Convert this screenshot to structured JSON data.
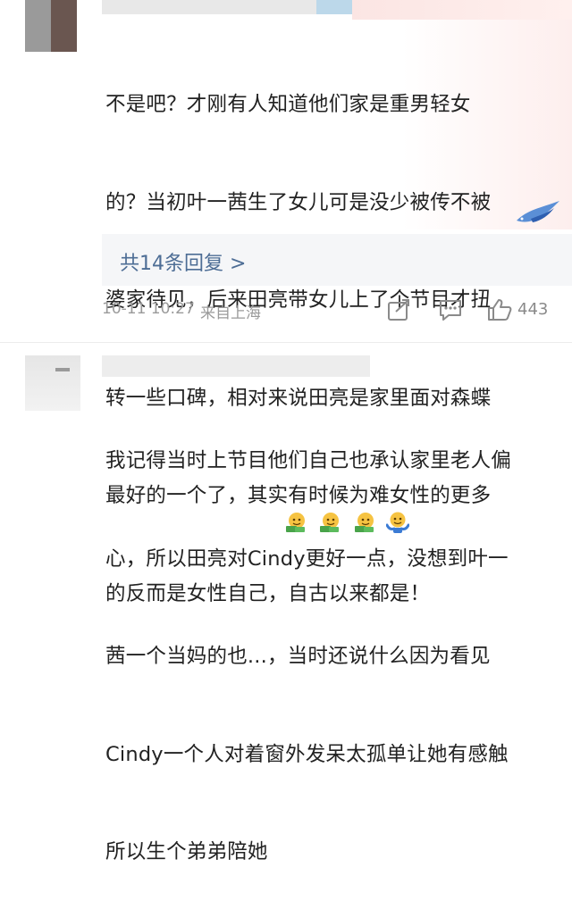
{
  "comment1": {
    "lines": [
      "不是吧？才刚有人知道他们家是重男轻女",
      "的？当初叶一茜生了女儿可是没少被传不被",
      "婆家待见，后来田亮带女儿上了个节目才扭",
      "转一些口碑，相对来说田亮是家里面对森蝶",
      "最好的一个了，其实有时候为难女性的更多",
      "的反而是女性自己，自古以来都是！"
    ],
    "replies_label": "共14条回复 >",
    "time": "10-11 10:27",
    "location": "来自上海",
    "like_count": "443",
    "icons": [
      "share-icon",
      "comment-icon",
      "like-icon"
    ]
  },
  "comment2": {
    "lines": [
      "我记得当时上节目他们自己也承认家里老人偏",
      "心，所以田亮对Cindy更好一点，没想到叶一",
      "茜一个当妈的也...，当时还说什么因为看见",
      "Cindy一个人对着窗外发呆太孤单让她有感触",
      "所以生个弟弟陪她"
    ],
    "emojis": [
      "money-face-icon",
      "money-face-icon",
      "money-face-icon",
      "shrug-face-icon"
    ]
  }
}
